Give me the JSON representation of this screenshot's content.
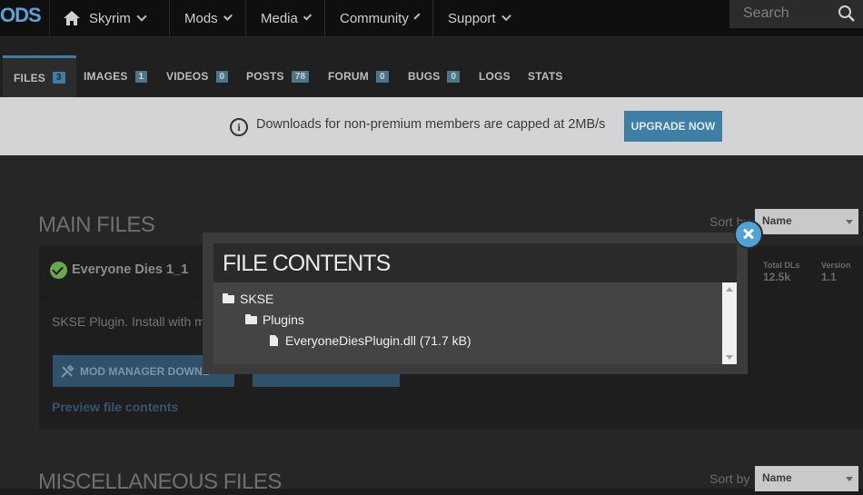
{
  "brand": {
    "logo_text": "ODS"
  },
  "nav": {
    "game": "Skyrim",
    "items": [
      "Mods",
      "Media",
      "Community",
      "Support"
    ],
    "search_placeholder": "Search"
  },
  "tabs": [
    {
      "label": "FILES",
      "count": "3",
      "active": true
    },
    {
      "label": "IMAGES",
      "count": "1"
    },
    {
      "label": "VIDEOS",
      "count": "0"
    },
    {
      "label": "POSTS",
      "count": "78"
    },
    {
      "label": "FORUM",
      "count": "0"
    },
    {
      "label": "BUGS",
      "count": "0"
    },
    {
      "label": "LOGS"
    },
    {
      "label": "STATS"
    }
  ],
  "notice": {
    "message": "Downloads for non-premium members are capped at 2MB/s",
    "button": "UPGRADE NOW"
  },
  "main_files": {
    "title": "MAIN FILES",
    "sort_label": "Sort by",
    "sort_value": "Name",
    "file": {
      "name": "Everyone Dies 1_1",
      "total_dls_label": "Total DLs",
      "total_dls": "12.5k",
      "version_label": "Version",
      "version": "1.1",
      "description": "SKSE Plugin. Install with m",
      "mod_manager_button": "MOD MANAGER DOWNL",
      "preview_link": "Preview file contents"
    }
  },
  "misc_files": {
    "title": "MISCELLANEOUS FILES",
    "sort_label": "Sort by",
    "sort_value": "Name"
  },
  "modal": {
    "title": "FILE CONTENTS",
    "tree": [
      {
        "name": "SKSE",
        "type": "folder",
        "depth": 0
      },
      {
        "name": "Plugins",
        "type": "folder",
        "depth": 1
      },
      {
        "name": "EveryoneDiesPlugin.dll (71.7 kB)",
        "type": "file",
        "depth": 2
      }
    ]
  },
  "colors": {
    "accent": "#3e7fa6",
    "close_button": "#4ea2d4",
    "check": "#6aa84f"
  }
}
